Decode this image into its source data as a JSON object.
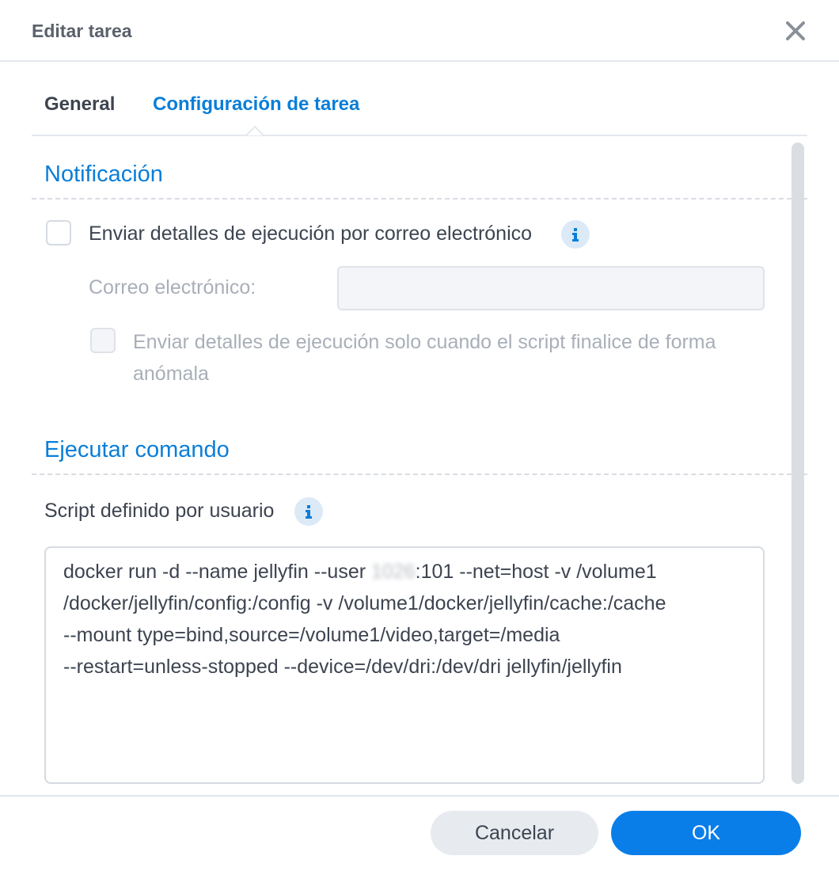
{
  "dialog": {
    "title": "Editar tarea"
  },
  "tabs": [
    {
      "label": "General",
      "active": false
    },
    {
      "label": "Configuración de tarea",
      "active": true
    }
  ],
  "notification": {
    "section_title": "Notificación",
    "send_details_label": "Enviar detalles de ejecución por correo electrónico",
    "send_details_checked": false,
    "email_label": "Correo electrónico:",
    "email_value": "",
    "abnormal_only_label": "Enviar detalles de ejecución solo cuando el script finalice de forma anómala",
    "abnormal_only_checked": false
  },
  "run_command": {
    "section_title": "Ejecutar comando",
    "script_label": "Script definido por usuario",
    "script_lines": [
      {
        "before": "docker run -d --name jellyfin --user ",
        "blurred": "1026",
        "after": ":101 --net=host -v /volume1"
      },
      {
        "text": "/docker/jellyfin/config:/config -v /volume1/docker/jellyfin/cache:/cache"
      },
      {
        "text": "--mount type=bind,source=/volume1/video,target=/media"
      },
      {
        "text": "--restart=unless-stopped --device=/dev/dri:/dev/dri jellyfin/jellyfin"
      }
    ]
  },
  "footer": {
    "cancel_label": "Cancelar",
    "ok_label": "OK"
  },
  "colors": {
    "accent": "#0a7ed8",
    "primary_button": "#0a7ee8",
    "secondary_button": "#e7ebf0",
    "info_icon_bg": "#dce9f7"
  },
  "icons": {
    "close": "close-icon",
    "info": "info-icon"
  }
}
